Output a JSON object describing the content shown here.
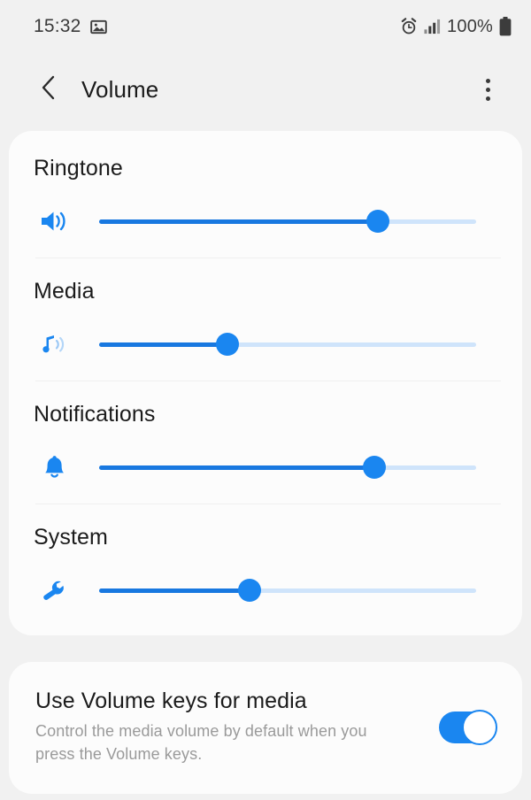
{
  "statusbar": {
    "time": "15:32",
    "battery_percent": "100%",
    "icons": [
      "gallery-icon",
      "alarm-icon",
      "signal-icon",
      "battery-icon"
    ]
  },
  "appbar": {
    "back_label": "Back",
    "title": "Volume",
    "menu_label": "More options"
  },
  "colors": {
    "accent": "#1a86f0",
    "fill": "#1878e0",
    "track": "#cfe4fb",
    "page_bg": "#f1f1f1",
    "card_bg": "#fcfcfc",
    "title_text": "#1b1b1b",
    "sub_text": "#9a9a9a"
  },
  "volume_sliders": [
    {
      "label": "Ringtone",
      "icon": "speaker-icon",
      "value": 74,
      "min": 0,
      "max": 100
    },
    {
      "label": "Media",
      "icon": "music-note-icon",
      "value": 34,
      "min": 0,
      "max": 100
    },
    {
      "label": "Notifications",
      "icon": "bell-icon",
      "value": 73,
      "min": 0,
      "max": 100
    },
    {
      "label": "System",
      "icon": "wrench-icon",
      "value": 40,
      "min": 0,
      "max": 100
    }
  ],
  "volume_keys_setting": {
    "title": "Use Volume keys for media",
    "description": "Control the media volume by default when you press the Volume keys.",
    "enabled": true
  }
}
